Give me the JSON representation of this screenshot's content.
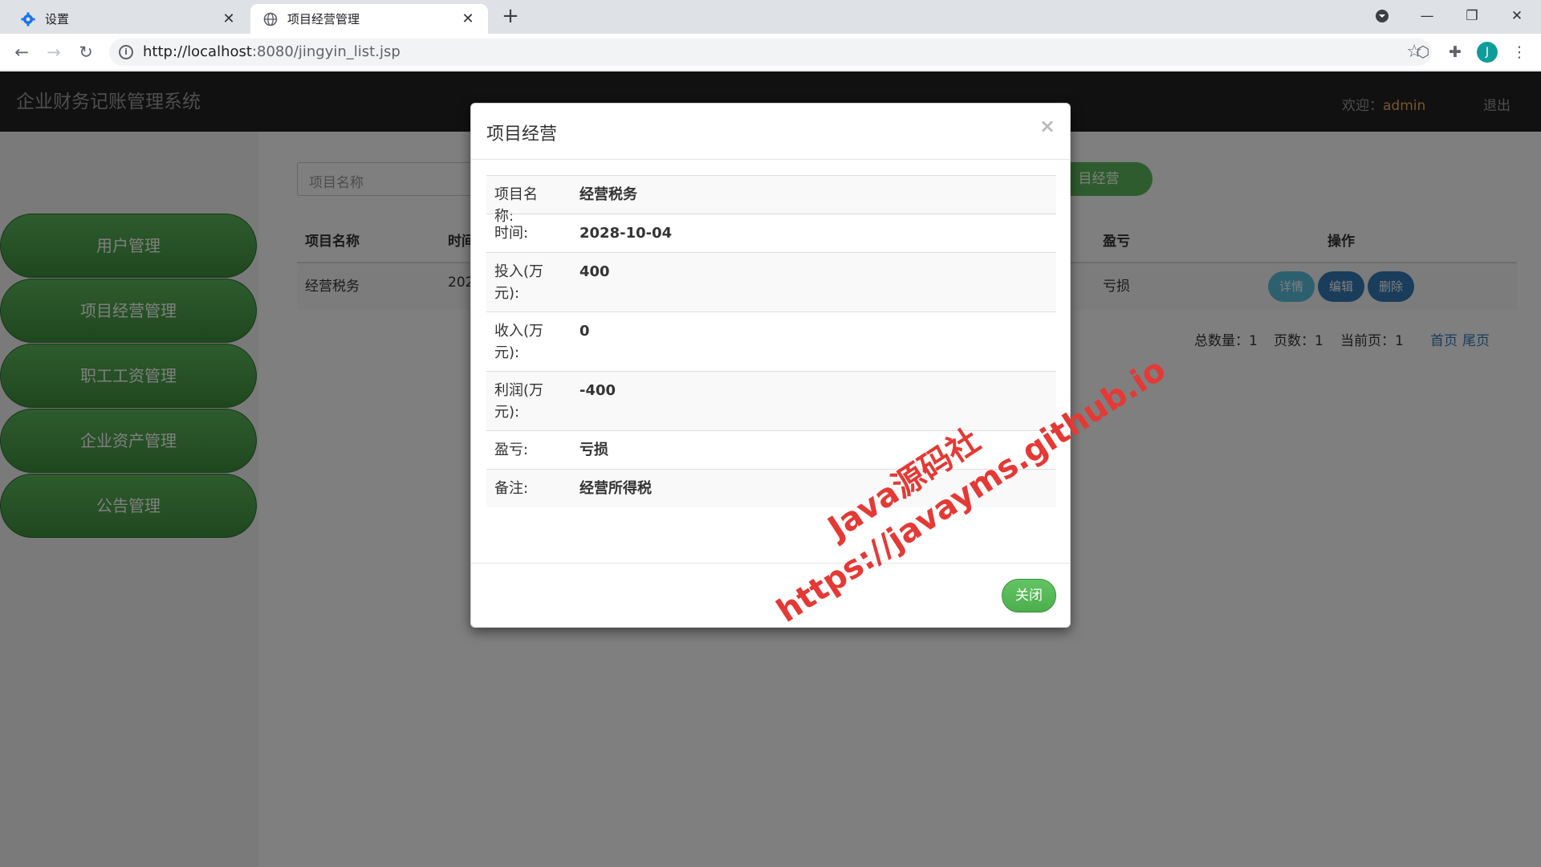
{
  "browser": {
    "tabs": [
      {
        "title": "设置",
        "icon": "gear-icon",
        "active": false
      },
      {
        "title": "项目经营管理",
        "icon": "globe-icon",
        "active": true
      }
    ],
    "new_tab": "+",
    "url_host": "http://localhost",
    "url_rest": ":8080/jingyin_list.jsp",
    "avatar_letter": "J"
  },
  "app": {
    "brand": "企业财务记账管理系统",
    "welcome_label": "欢迎：",
    "username": "admin",
    "logout": "退出"
  },
  "sidebar": {
    "items": [
      {
        "label": "用户管理"
      },
      {
        "label": "项目经营管理"
      },
      {
        "label": "职工工资管理"
      },
      {
        "label": "企业资产管理"
      },
      {
        "label": "公告管理"
      }
    ]
  },
  "toolbar": {
    "search_placeholder": "项目名称",
    "add_label": "目经营"
  },
  "table": {
    "headers": [
      "项目名称",
      "时间",
      "盈亏",
      "操作"
    ],
    "rows": [
      {
        "name": "经营税务",
        "time": "202",
        "profit_loss": "亏损"
      }
    ],
    "actions": {
      "detail": "详情",
      "edit": "编辑",
      "delete": "删除"
    }
  },
  "pager": {
    "total": "总数量：1",
    "pages": "页数：1",
    "current": "当前页：1",
    "first": "首页",
    "last": "尾页"
  },
  "modal": {
    "title": "项目经营",
    "close_x": "×",
    "fields": [
      {
        "key": "项目名称:",
        "value": "经营税务"
      },
      {
        "key": "时间:",
        "value": "2028-10-04"
      },
      {
        "key": "投入(万元):",
        "value": "400"
      },
      {
        "key": "收入(万元):",
        "value": "0"
      },
      {
        "key": "利润(万元):",
        "value": "-400"
      },
      {
        "key": "盈亏:",
        "value": "亏损"
      },
      {
        "key": "备注:",
        "value": "经营所得税"
      }
    ],
    "close_button": "关闭"
  },
  "watermark": {
    "line1": "Java源码社",
    "line2": "https://javayms.github.io"
  },
  "colors": {
    "accent_green": "#5cb85c",
    "info_blue": "#5bc0de",
    "primary_blue": "#337ab7",
    "navbar": "#222222",
    "username": "#f0ad4e",
    "watermark": "#e53935"
  }
}
